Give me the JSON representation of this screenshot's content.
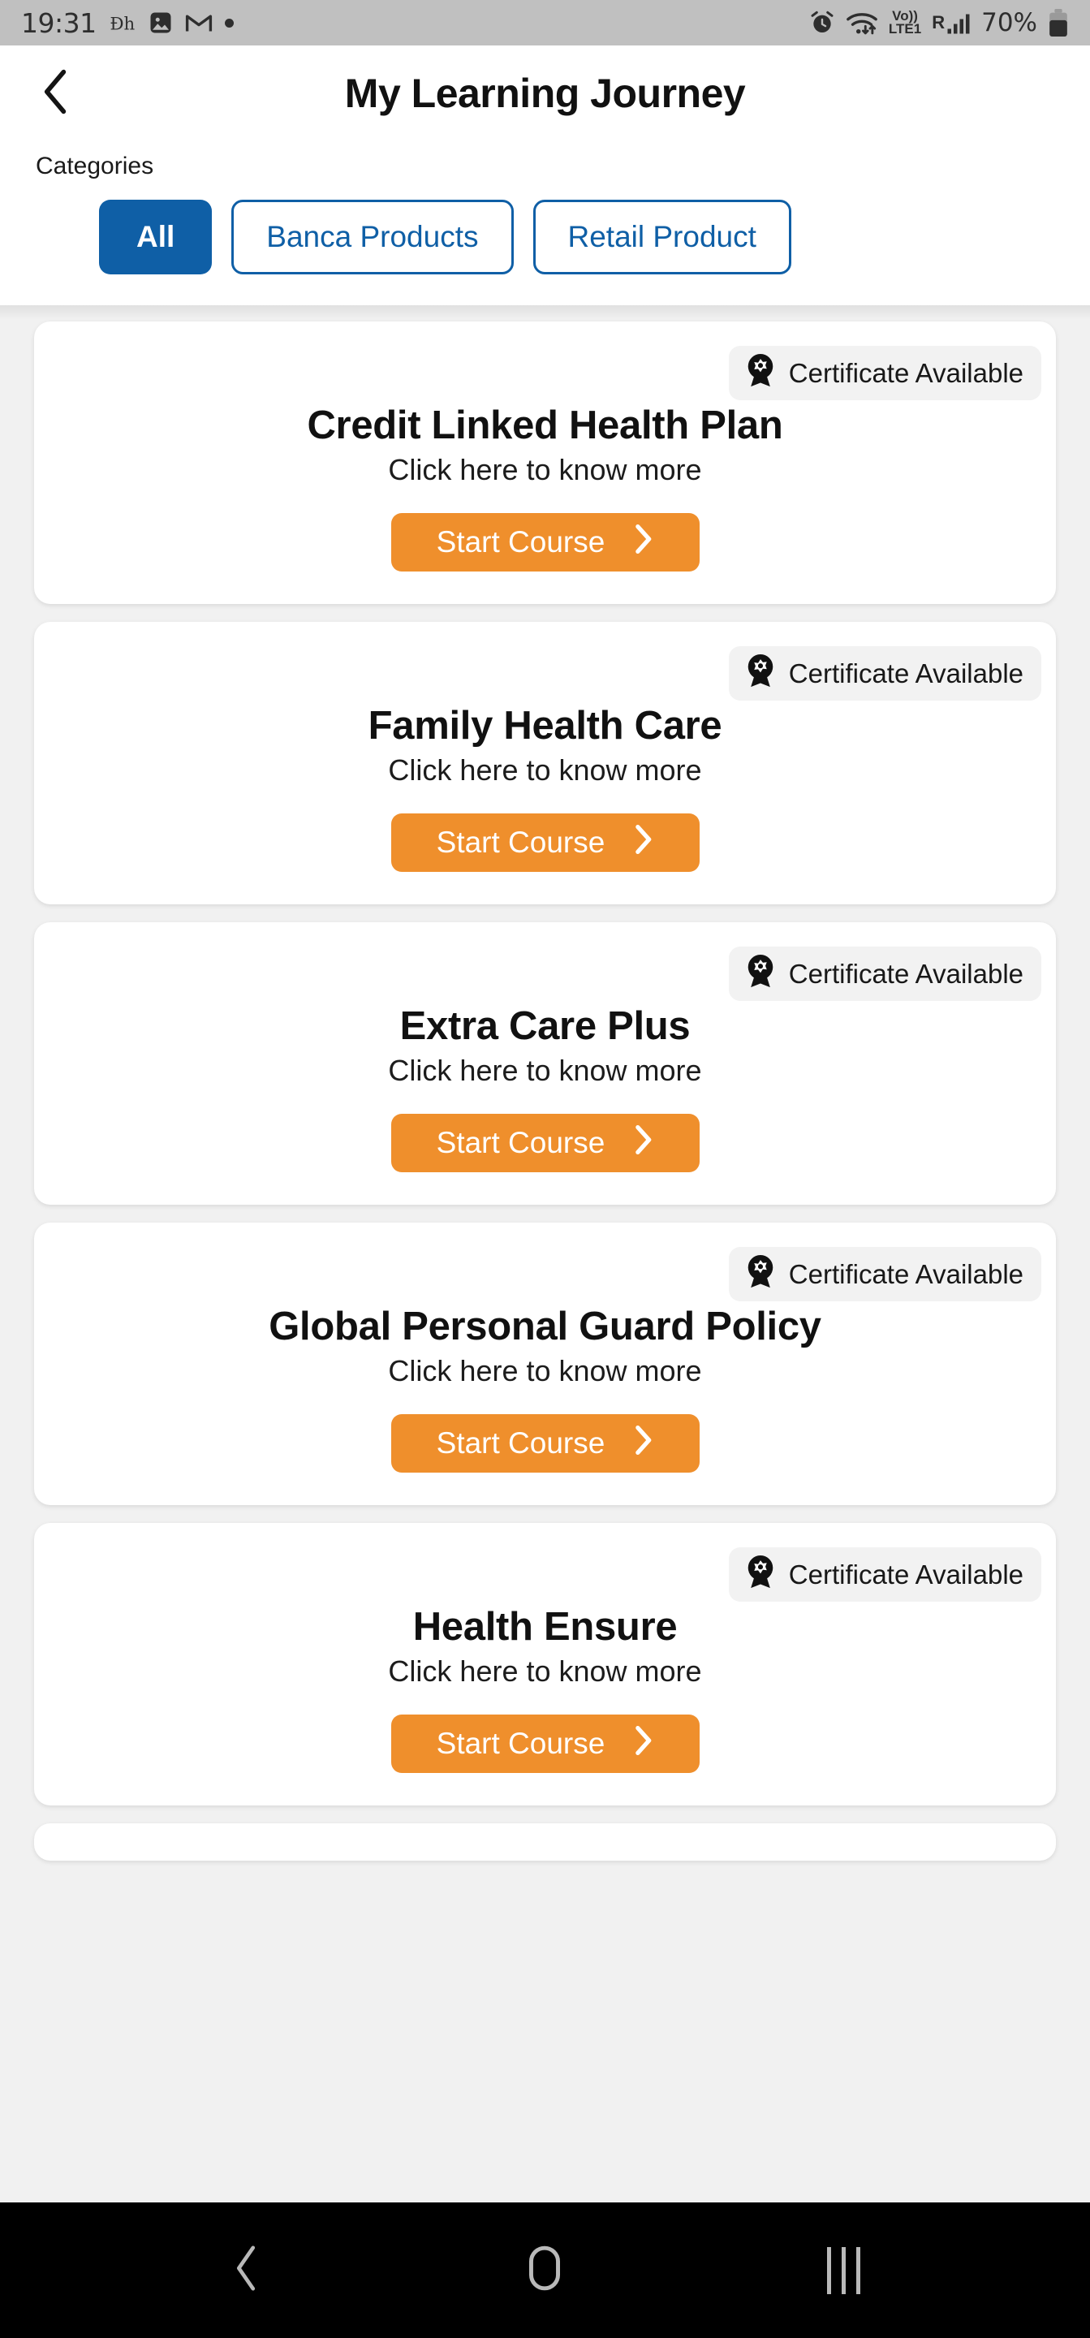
{
  "status_bar": {
    "time": "19:31",
    "left_icons": [
      "disney-plus-icon",
      "gallery-icon",
      "gmail-icon",
      "notification-dot-icon"
    ],
    "right_icons": [
      "alarm-icon",
      "wifi-icon",
      "volte-icon",
      "roaming-signal-icon"
    ],
    "network_line1": "Vo))",
    "network_line2": "LTE1",
    "roaming": "R",
    "battery_percent": "70%"
  },
  "header": {
    "back_icon": "chevron-left-icon",
    "title": "My Learning Journey"
  },
  "categories": {
    "label": "Categories",
    "chips": [
      {
        "label": "All",
        "selected": true
      },
      {
        "label": "Banca Products",
        "selected": false
      },
      {
        "label": "Retail Product",
        "selected": false
      }
    ]
  },
  "colors": {
    "accent_blue": "#0f5fa6",
    "accent_orange": "#ef8f2c",
    "badge_bg": "#f2f2f2",
    "page_bg": "#f1f1f1",
    "statusbar_bg": "#c0c0c0",
    "navbar_bg": "#000000"
  },
  "common": {
    "badge_text": "Certificate Available",
    "badge_icon": "certificate-award-icon",
    "subtitle": "Click here to know more",
    "cta_label": "Start Course",
    "cta_icon": "chevron-right-icon"
  },
  "courses": [
    {
      "title": "Credit Linked Health Plan",
      "badge": "Certificate Available",
      "subtitle": "Click here to know more",
      "cta": "Start Course"
    },
    {
      "title": "Family Health Care",
      "badge": "Certificate Available",
      "subtitle": "Click here to know more",
      "cta": "Start Course"
    },
    {
      "title": "Extra Care Plus",
      "badge": "Certificate Available",
      "subtitle": "Click here to know more",
      "cta": "Start Course"
    },
    {
      "title": "Global Personal Guard Policy",
      "badge": "Certificate Available",
      "subtitle": "Click here to know more",
      "cta": "Start Course"
    },
    {
      "title": "Health Ensure",
      "badge": "Certificate Available",
      "subtitle": "Click here to know more",
      "cta": "Start Course"
    }
  ],
  "nav_bar": {
    "items": [
      {
        "icon": "back-nav-icon"
      },
      {
        "icon": "home-nav-icon"
      },
      {
        "icon": "recents-nav-icon"
      }
    ]
  }
}
